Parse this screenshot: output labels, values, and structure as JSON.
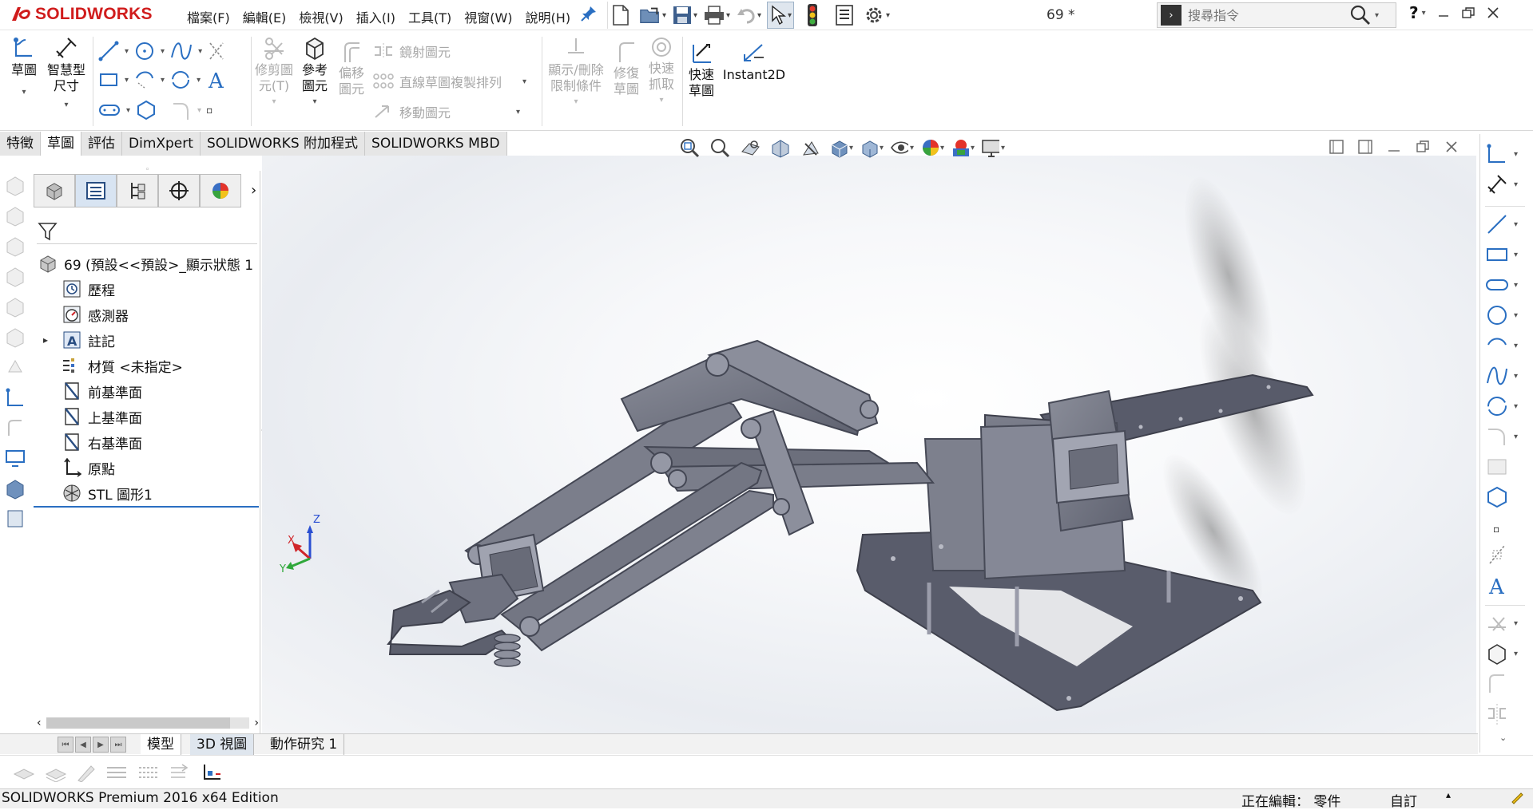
{
  "app": {
    "brand": "SOLIDWORKS",
    "doc_title": "69 *"
  },
  "menu": [
    "檔案(F)",
    "編輯(E)",
    "檢視(V)",
    "插入(I)",
    "工具(T)",
    "視窗(W)",
    "說明(H)"
  ],
  "search": {
    "placeholder": "搜尋指令",
    "prompt_icon": "›"
  },
  "window": {
    "help": "?"
  },
  "ribbon": {
    "sketch": "草圖",
    "smart_dimension": [
      "智慧型",
      "尺寸"
    ],
    "trim": [
      "修剪圖",
      "元(T)"
    ],
    "convert": [
      "參考",
      "圖元"
    ],
    "offset": [
      "偏移",
      "圖元"
    ],
    "mirror": "鏡射圖元",
    "linear_pattern": "直線草圖複製排列",
    "move": "移動圖元",
    "relations": [
      "顯示/刪除",
      "限制條件"
    ],
    "repair": [
      "修復",
      "草圖"
    ],
    "quick_snap": [
      "快速",
      "抓取"
    ],
    "rapid_sketch": [
      "快速",
      "草圖"
    ],
    "instant2d": "Instant2D"
  },
  "tabs": [
    "特徵",
    "草圖",
    "評估",
    "DimXpert",
    "SOLIDWORKS 附加程式",
    "SOLIDWORKS MBD"
  ],
  "active_tab": "草圖",
  "tree": {
    "root": "69  (預設<<預設>_顯示狀態 1",
    "items": [
      {
        "label": "歷程",
        "icon": "history-icon",
        "expandable": false
      },
      {
        "label": "感測器",
        "icon": "sensor-icon",
        "expandable": false
      },
      {
        "label": "註記",
        "icon": "annotation-icon",
        "expandable": true
      },
      {
        "label": "材質 <未指定>",
        "icon": "material-icon",
        "expandable": false
      },
      {
        "label": "前基準面",
        "icon": "plane-icon",
        "expandable": false
      },
      {
        "label": "上基準面",
        "icon": "plane-icon",
        "expandable": false
      },
      {
        "label": "右基準面",
        "icon": "plane-icon",
        "expandable": false
      },
      {
        "label": "原點",
        "icon": "origin-icon",
        "expandable": false
      },
      {
        "label": "STL 圖形1",
        "icon": "stl-graphic-icon",
        "expandable": false
      }
    ]
  },
  "bottom_tabs": [
    "模型",
    "3D 視圖",
    "動作研究 1"
  ],
  "active_bottom_tab": "模型",
  "triad": {
    "x": "X",
    "y": "Y",
    "z": "Z"
  },
  "status": {
    "edition": "SOLIDWORKS Premium 2016 x64 Edition",
    "editing": "正在編輯：  零件",
    "units": "自訂"
  },
  "colors": {
    "brand_red": "#d01c1c",
    "model_gray": "#6e7180",
    "selection_blue": "#2a6fc2"
  }
}
